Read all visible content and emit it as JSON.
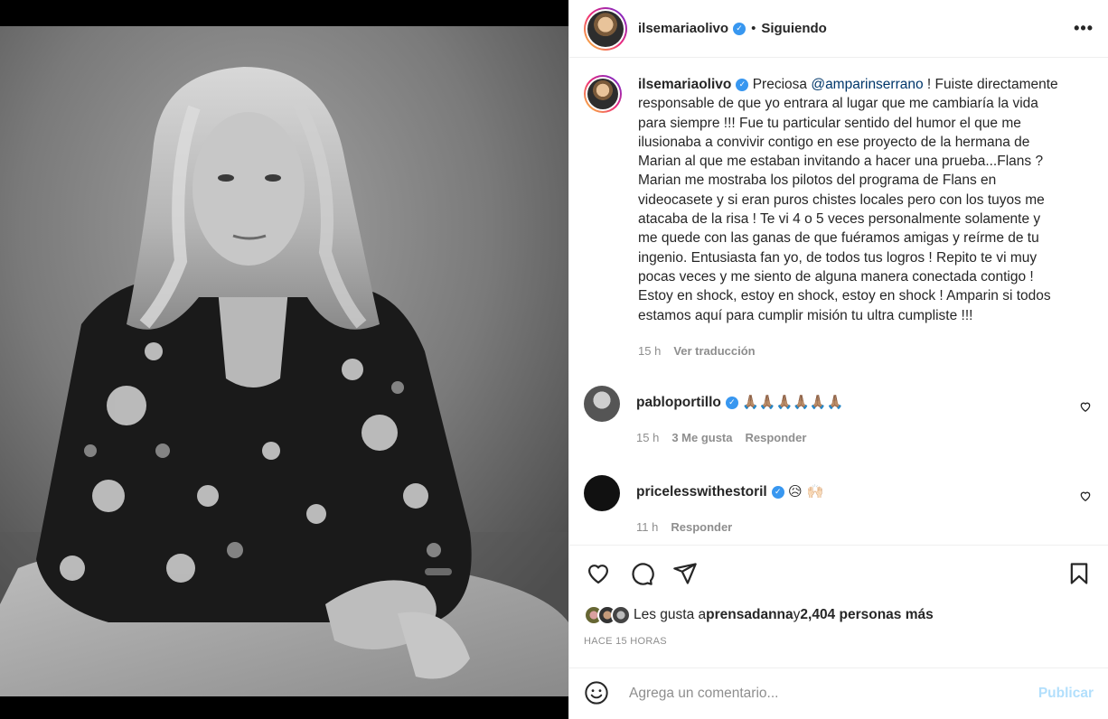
{
  "header": {
    "username": "ilsemariaolivo",
    "separator": "•",
    "follow_status": "Siguiendo",
    "more": "•••"
  },
  "caption": {
    "username": "ilsemariaolivo",
    "text_before_mention": "Preciosa ",
    "mention": "@amparinserrano",
    "text_after_mention": " ! Fuiste directamente responsable de que yo entrara al lugar que me cambiaría la vida para siempre !!! Fue tu particular sentido del humor el que me ilusionaba a convivir contigo en ese proyecto de la hermana de Marian al que me estaban invitando a hacer una prueba...Flans ? Marian me mostraba los pilotos del programa de Flans en videocasete y si eran puros chistes locales pero con los tuyos me atacaba de la risa ! Te vi 4 o 5 veces personalmente solamente y me quede con las ganas de que fuéramos amigas y reírme de tu ingenio. Entusiasta fan yo, de todos tus logros ! Repito te vi muy pocas veces y me siento de alguna manera conectada contigo ! Estoy en shock, estoy en shock, estoy en shock ! Amparin si todos estamos aquí para cumplir misión tu ultra cumpliste !!!",
    "time": "15 h",
    "translate": "Ver traducción"
  },
  "comments": [
    {
      "username": "pabloportillo",
      "text": "🙏🏽🙏🏽🙏🏽🙏🏽🙏🏽🙏🏽",
      "time": "15 h",
      "likes": "3 Me gusta",
      "reply": "Responder"
    },
    {
      "username": "pricelesswithestoril",
      "text": "😥 🙌🏻",
      "time": "11 h",
      "reply": "Responder"
    }
  ],
  "likes": {
    "prefix": "Les gusta a ",
    "first_user": "prensadanna",
    "connector": " y ",
    "others": "2,404 personas más"
  },
  "time_ago": "HACE 15 HORAS",
  "composer": {
    "placeholder": "Agrega un comentario...",
    "publish": "Publicar"
  },
  "colors": {
    "verified": "#3897f0",
    "mention": "#00376b",
    "muted": "#8e8e8e",
    "publish_disabled": "#b2dffc"
  },
  "icons": [
    "verified-icon",
    "heart-icon",
    "comment-icon",
    "share-icon",
    "bookmark-icon",
    "emoji-icon",
    "more-icon"
  ]
}
